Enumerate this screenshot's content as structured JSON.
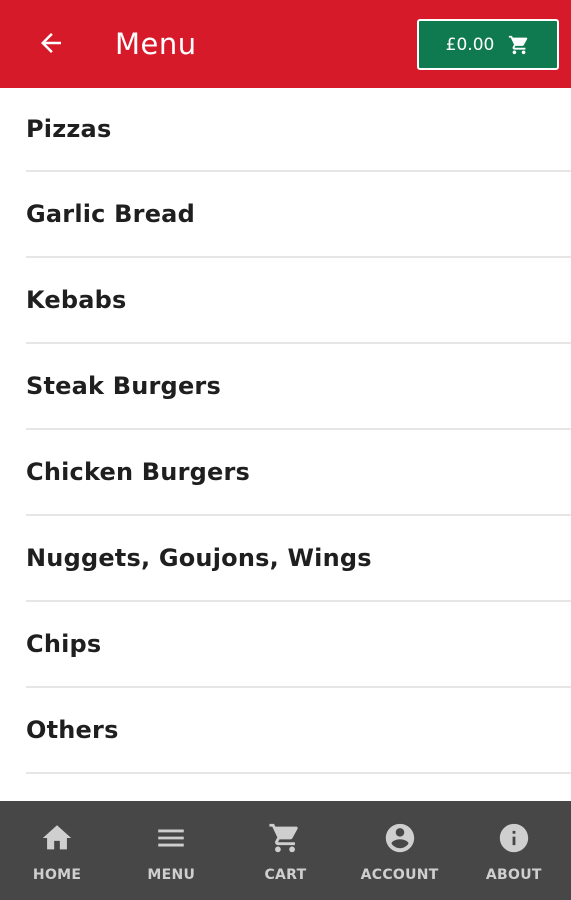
{
  "header": {
    "title": "Menu",
    "back_icon": "arrow-left-icon",
    "cart_total": "£0.00",
    "cart_icon": "cart-icon"
  },
  "menu": {
    "items": [
      {
        "label": "Pizzas"
      },
      {
        "label": "Garlic Bread"
      },
      {
        "label": "Kebabs"
      },
      {
        "label": "Steak Burgers"
      },
      {
        "label": "Chicken Burgers"
      },
      {
        "label": "Nuggets, Goujons, Wings"
      },
      {
        "label": "Chips"
      },
      {
        "label": "Others"
      }
    ]
  },
  "bottom_nav": {
    "items": [
      {
        "label": "HOME",
        "icon": "home-icon"
      },
      {
        "label": "MENU",
        "icon": "menu-icon"
      },
      {
        "label": "CART",
        "icon": "cart-icon"
      },
      {
        "label": "ACCOUNT",
        "icon": "account-icon"
      },
      {
        "label": "ABOUT",
        "icon": "info-icon"
      }
    ]
  },
  "colors": {
    "header_bg": "#d61a2a",
    "cart_button_bg": "#0f7a4f",
    "bottom_nav_bg": "#474747",
    "divider": "#e6e6e6"
  }
}
